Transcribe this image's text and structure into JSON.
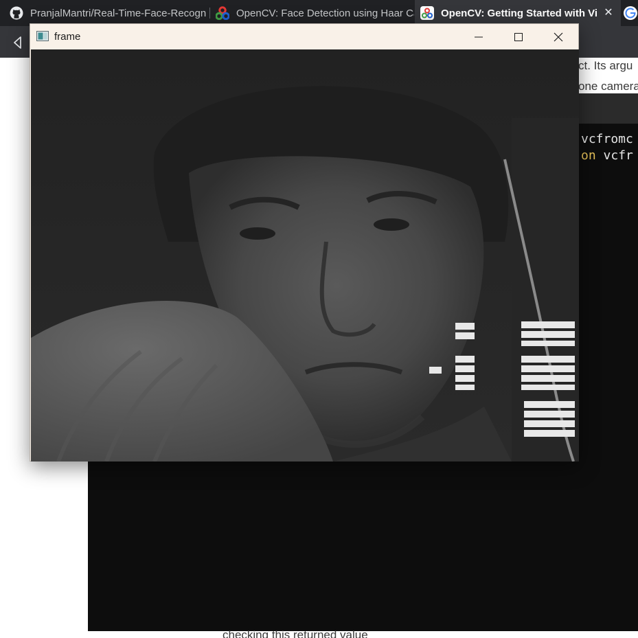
{
  "browser": {
    "tabs": [
      {
        "label": "PranjalMantri/Real-Time-Face-Recogni",
        "icon": "github-icon",
        "active": false
      },
      {
        "label": "OpenCV: Face Detection using Haar Ca",
        "icon": "opencv-icon",
        "active": false
      },
      {
        "label": "OpenCV: Getting Started with Vid",
        "icon": "opencv-icon",
        "active": true
      },
      {
        "label": "",
        "icon": "google-icon",
        "active": false
      }
    ],
    "close_tab_glyph": "✕"
  },
  "doc": {
    "line_1": "ct. Its argu",
    "line_2": "one camera",
    "code_line_1": "vcfromc",
    "code_line_2_kw": "on",
    "code_line_2_rest": " vcfr",
    "bottom_text": "checking this returned value"
  },
  "frame_window": {
    "title": "frame",
    "icons": {
      "app": "image-window-icon",
      "minimize": "minimize-icon",
      "maximize": "maximize-icon",
      "close": "close-icon"
    },
    "content": "grayscale webcam frame"
  },
  "colors": {
    "tabstrip_bg": "#202124",
    "toolbar_bg": "#35363a",
    "frame_titlebar_bg": "#f9f1e8",
    "code_bg": "#0d0d0d",
    "code_keyword": "#e8c35a"
  }
}
